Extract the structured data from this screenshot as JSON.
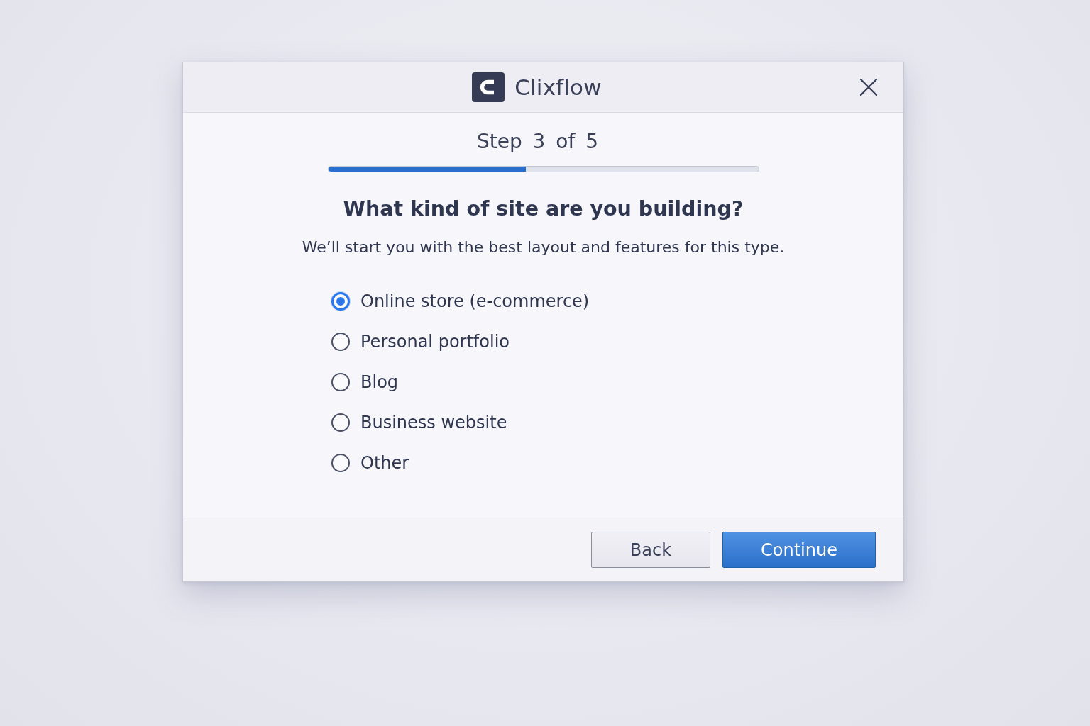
{
  "window": {
    "title": "Clixflow"
  },
  "progress": {
    "label": "Step 3 of 5",
    "level": 0.46
  },
  "question": {
    "title": "What kind of site are you building?",
    "subtitle": "We’ll start you with the best layout and features for this type."
  },
  "options": [
    {
      "label": "Online store (e-commerce)",
      "selected": true
    },
    {
      "label": "Personal portfolio",
      "selected": false
    },
    {
      "label": "Blog",
      "selected": false
    },
    {
      "label": "Business website",
      "selected": false
    },
    {
      "label": "Other",
      "selected": false
    }
  ],
  "buttons": [
    {
      "label": "Back",
      "kind": "secondary"
    },
    {
      "label": "Continue",
      "kind": "primary"
    }
  ]
}
